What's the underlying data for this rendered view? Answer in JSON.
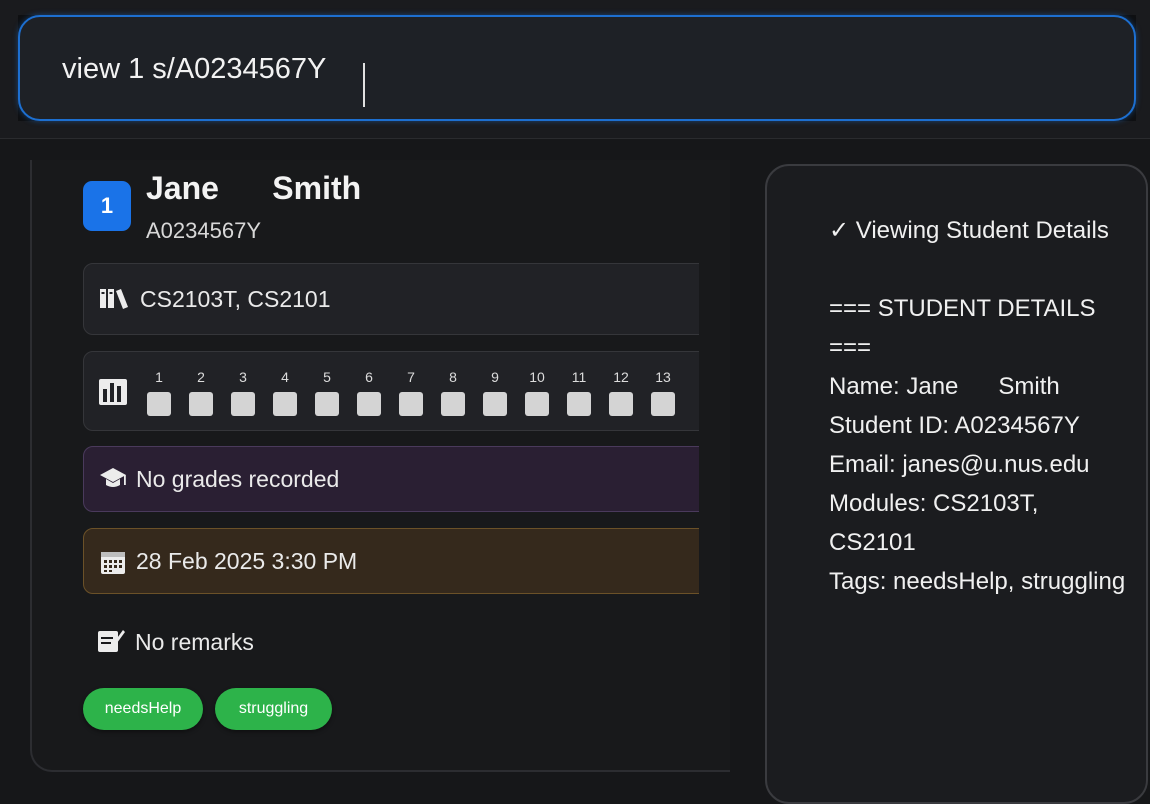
{
  "command": {
    "value": "view 1 s/A0234567Y"
  },
  "student": {
    "index": "1",
    "name": "Jane      Smith",
    "id": "A0234567Y",
    "modules_icon": "books-icon",
    "modules": "CS2103T, CS2101",
    "attendance_icon": "bar-chart-icon",
    "weeks": [
      "1",
      "2",
      "3",
      "4",
      "5",
      "6",
      "7",
      "8",
      "9",
      "10",
      "11",
      "12",
      "13"
    ],
    "grades_icon": "graduation-cap-icon",
    "grades": "No grades recorded",
    "date_icon": "calendar-icon",
    "date": "28 Feb 2025 3:30 PM",
    "remarks_icon": "memo-icon",
    "remarks": "No remarks",
    "tags": [
      "needsHelp",
      "struggling"
    ]
  },
  "result": {
    "text": "✓ Viewing Student Details\n\n=== STUDENT DETAILS ===\nName: Jane      Smith\nStudent ID: A0234567Y\nEmail: janes@u.nus.edu\nModules: CS2103T, CS2101\nTags: needsHelp, struggling"
  },
  "colors": {
    "accent": "#1a73e8",
    "tag": "#2db34a",
    "attendance_box": "#d4d4d4"
  }
}
